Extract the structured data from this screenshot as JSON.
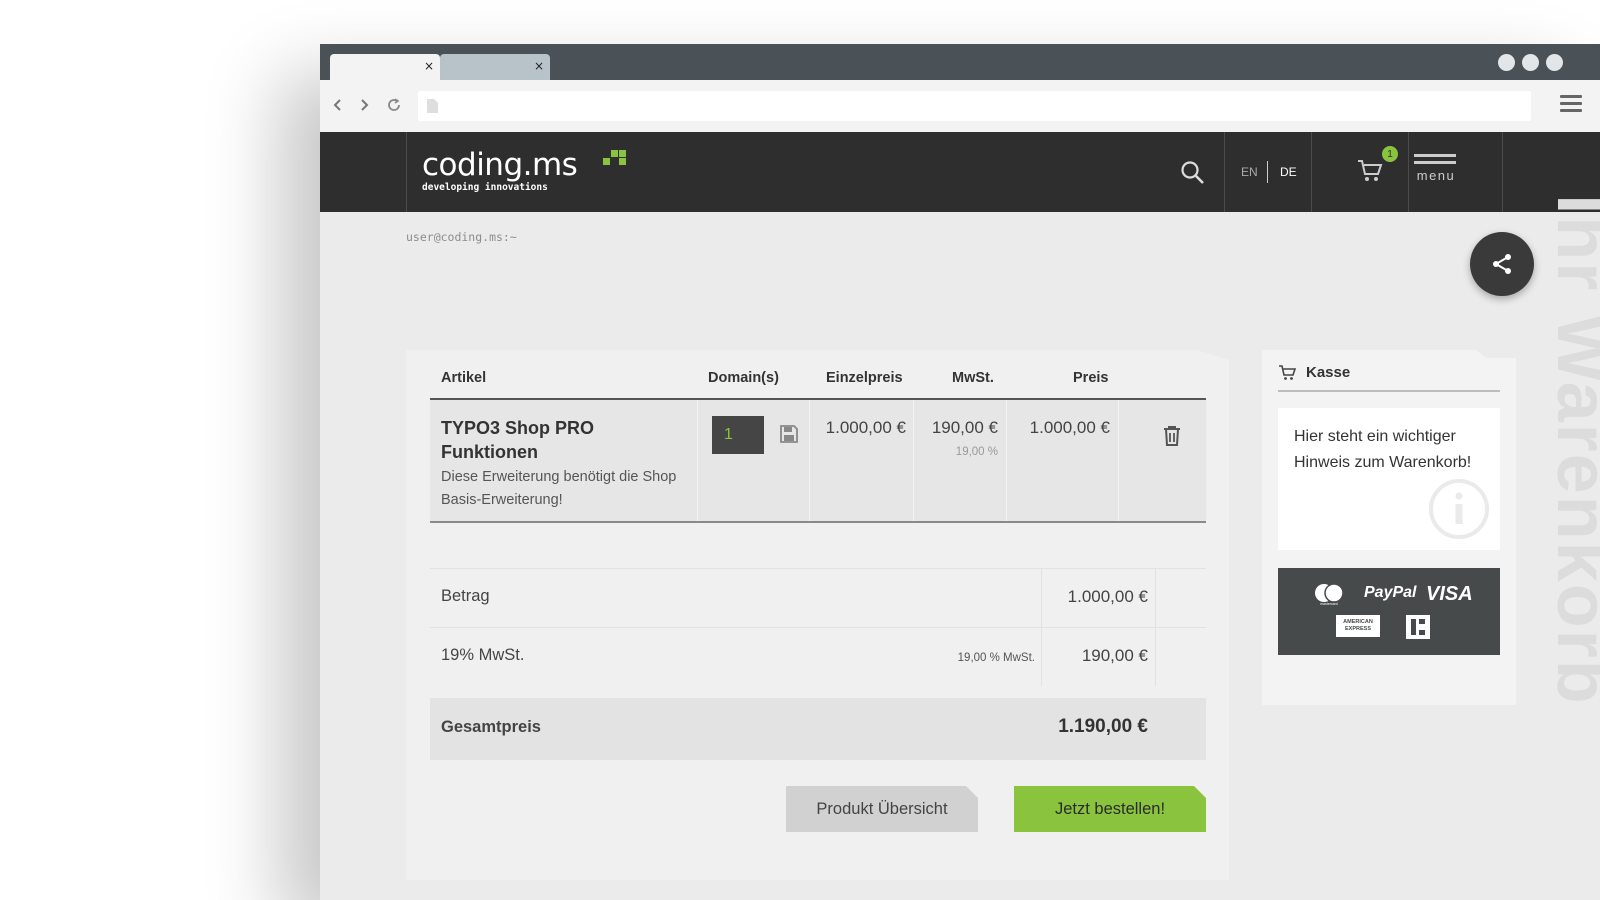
{
  "browser": {
    "tabs": [
      {
        "label": "",
        "close": "×",
        "active": true
      },
      {
        "label": "",
        "close": "×",
        "active": false
      }
    ],
    "url": ""
  },
  "header": {
    "logo_main": "coding.ms",
    "logo_tagline": "developing innovations",
    "languages": [
      "EN",
      "DE"
    ],
    "active_language": "DE",
    "cart_count": "1",
    "menu_label": "menu"
  },
  "prompt": "user@coding.ms:~",
  "side_title": "Ihr Warenkorb",
  "cart": {
    "columns": {
      "article": "Artikel",
      "domains": "Domain(s)",
      "unit_price": "Einzelpreis",
      "vat": "MwSt.",
      "price": "Preis"
    },
    "item": {
      "title": "TYPO3 Shop PRO Funktionen",
      "description": "Diese Erweiterung benötigt die Shop Basis-Erweiterung!",
      "quantity": "1",
      "unit_price": "1.000,00 €",
      "vat_amount": "190,00 €",
      "vat_rate": "19,00 %",
      "price": "1.000,00 €"
    },
    "summary": {
      "amount_label": "Betrag",
      "amount_value": "1.000,00 €",
      "vat_label": "19% MwSt.",
      "vat_note": "19,00 % MwSt.",
      "vat_value": "190,00 €",
      "total_label": "Gesamtpreis",
      "total_value": "1.190,00 €"
    },
    "buttons": {
      "overview": "Produkt Übersicht",
      "order": "Jetzt bestellen!"
    }
  },
  "checkout": {
    "title": "Kasse",
    "notice": "Hier steht ein wichtiger Hinweis zum Warenkorb!",
    "payment_methods": [
      "mastercard",
      "PayPal",
      "VISA",
      "AMERICAN EXPRESS",
      "EC"
    ],
    "payment_labels": {
      "mastercard": "mastercard",
      "paypal": "PayPal",
      "visa": "VISA",
      "amex": "AMERICAN EXPRESS"
    }
  },
  "colors": {
    "accent": "#8ac43f",
    "header_bg": "#2e2e2e",
    "tabbar_bg": "#4a5257",
    "page_bg": "#ebebeb"
  }
}
